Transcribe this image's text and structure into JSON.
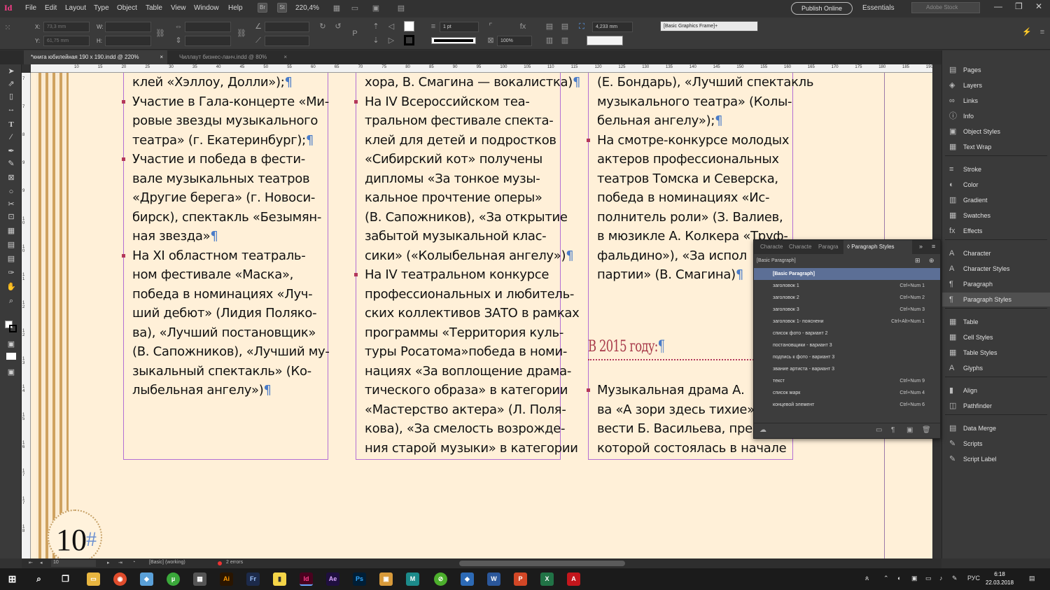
{
  "app": {
    "logo": "Id",
    "menu": [
      "File",
      "Edit",
      "Layout",
      "Type",
      "Object",
      "Table",
      "View",
      "Window",
      "Help"
    ],
    "menu_x": [
      36,
      64,
      93,
      134,
      167,
      208,
      244,
      277,
      326
    ],
    "zoom": "220,4%",
    "publish_label": "Publish Online",
    "workspace": "Essentials",
    "stock_placeholder": "Adobe Stock"
  },
  "control": {
    "x_label": "X:",
    "x_value": "73,3 mm",
    "y_label": "Y:",
    "y_value": "61,75 mm",
    "w_label": "W:",
    "h_label": "H:",
    "stroke_weight": "1 pt",
    "scale": "100%",
    "gap": "4,233 mm",
    "object_style": "[Basic Graphics Frame]+"
  },
  "tabs": [
    {
      "label": "*книга юбилейная 190 х 190.indd @ 220%",
      "close": "×"
    },
    {
      "label": "Чиллаут бизнес-ланч.indd @ 80%",
      "close": "×"
    }
  ],
  "ruler": {
    "h": [
      "10",
      "15",
      "20",
      "25",
      "30",
      "35",
      "40",
      "45",
      "50",
      "55",
      "60",
      "65",
      "70",
      "75",
      "80",
      "85",
      "90",
      "95",
      "100",
      "105",
      "110",
      "115",
      "120",
      "125",
      "130",
      "135",
      "140",
      "145",
      "150",
      "155",
      "160",
      "165",
      "170",
      "175",
      "180",
      "185",
      "190",
      "195"
    ],
    "v": [
      "7",
      "7",
      "8",
      "9",
      "9",
      "1\n0",
      "1\n0",
      "1\n1",
      "1\n2",
      "1\n2",
      "1\n3",
      "1\n4",
      "1\n5",
      "1\n6",
      "1\n7",
      "1\n7",
      "1\n8"
    ]
  },
  "document": {
    "page_number": "10",
    "page_hash": "#",
    "col1": [
      {
        "t": "клей «Хэллоу, Долли»);",
        "p": "¶"
      },
      {
        "t": "Участие в Гала-концерте «Ми-",
        "b": true
      },
      {
        "t": "ровые звезды музыкального"
      },
      {
        "t": "театра» (г. Екатеринбург);",
        "p": "¶"
      },
      {
        "t": "Участие и победа в фести-",
        "b": true
      },
      {
        "t": "вале музыкальных театров"
      },
      {
        "t": "«Другие берега» (г. Новоси-"
      },
      {
        "t": "бирск), спектакль «Безымян-"
      },
      {
        "t": "ная звезда»",
        "p": "¶"
      },
      {
        "t": "На XI областном театраль-",
        "b": true
      },
      {
        "t": "ном фестивале «Маска»,"
      },
      {
        "t": "победа в номинациях «Луч-"
      },
      {
        "t": "ший дебют» (Лидия Поляко-"
      },
      {
        "t": "ва), «Лучший постановщик»"
      },
      {
        "t": "(В. Сапожников), «Лучший му-"
      },
      {
        "t": "зыкальный спектакль» (Ко-"
      },
      {
        "t": "лыбельная ангелу»)",
        "p": "¶"
      }
    ],
    "col2": [
      {
        "t": "хора, В. Смагина — вокалистка)",
        "p": "¶"
      },
      {
        "t": "На IV Всероссийском теа-",
        "b": true
      },
      {
        "t": "тральном фестивале спекта-"
      },
      {
        "t": "клей для детей и подростков"
      },
      {
        "t": "«Сибирский кот» получены"
      },
      {
        "t": "дипломы «За тонкое музы-"
      },
      {
        "t": "кальное прочтение оперы»"
      },
      {
        "t": "(В. Сапожников), «За открытие"
      },
      {
        "t": "забытой музыкальной клас-"
      },
      {
        "t": "сики» («Колыбельная ангелу»)",
        "p": "¶"
      },
      {
        "t": "На IV театральном конкурсе",
        "b": true
      },
      {
        "t": "профессиональных и любитель-"
      },
      {
        "t": "ских коллективов ЗАТО в рамках"
      },
      {
        "t": "программы «Территория куль-"
      },
      {
        "t": "туры Росатома»победа в номи-"
      },
      {
        "t": "нациях «За воплощение драма-"
      },
      {
        "t": "тического образа» в категории"
      },
      {
        "t": "«Мастерство актера» (Л. Поля-"
      },
      {
        "t": "кова), «За смелость возрожде-"
      },
      {
        "t": "ния старой музыки» в категории"
      }
    ],
    "col3": [
      {
        "t": "(Е. Бондарь), «Лучший спектакль"
      },
      {
        "t": "музыкального театра» (Колы-"
      },
      {
        "t": "бельная ангелу»);",
        "p": "¶"
      },
      {
        "t": "На смотре-конкурсе молодых",
        "b": true
      },
      {
        "t": "актеров профессиональных"
      },
      {
        "t": "театров Томска и Северска,"
      },
      {
        "t": "победа в номинациях «Ис-"
      },
      {
        "t": "полнитель роли» (З. Валиев,"
      },
      {
        "t": "в мюзикле А. Колкера «Труф-"
      },
      {
        "t": "фальдино»), «За испол"
      },
      {
        "t": "партии» (В. Смагина)",
        "p": "¶"
      }
    ],
    "heading": "В 2015 году:",
    "heading_pil": "¶",
    "col3b": [
      {
        "t": "Музыкальная драма А.",
        "b": true
      },
      {
        "t": "ва «А зори здесь тихие»"
      },
      {
        "t": "вести Б. Васильева, пре"
      },
      {
        "t": "которой состоялась в начале"
      }
    ]
  },
  "panels": [
    {
      "label": "Pages",
      "icon": "▤"
    },
    {
      "label": "Layers",
      "icon": "◈"
    },
    {
      "label": "Links",
      "icon": "∞"
    },
    {
      "label": "Info",
      "icon": "ⓘ"
    },
    {
      "label": "Object Styles",
      "icon": "▣"
    },
    {
      "label": "Text Wrap",
      "icon": "▦"
    },
    {
      "label": "Stroke",
      "icon": "≡"
    },
    {
      "label": "Color",
      "icon": "◐"
    },
    {
      "label": "Gradient",
      "icon": "▥"
    },
    {
      "label": "Swatches",
      "icon": "▦"
    },
    {
      "label": "Effects",
      "icon": "fx"
    },
    {
      "label": "Character",
      "icon": "A"
    },
    {
      "label": "Character Styles",
      "icon": "A"
    },
    {
      "label": "Paragraph",
      "icon": "¶"
    },
    {
      "label": "Paragraph Styles",
      "icon": "¶"
    },
    {
      "label": "Table",
      "icon": "▦"
    },
    {
      "label": "Cell Styles",
      "icon": "▦"
    },
    {
      "label": "Table Styles",
      "icon": "▦"
    },
    {
      "label": "Glyphs",
      "icon": "A"
    },
    {
      "label": "Align",
      "icon": "▮"
    },
    {
      "label": "Pathfinder",
      "icon": "◫"
    },
    {
      "label": "Data Merge",
      "icon": "▤"
    },
    {
      "label": "Scripts",
      "icon": "✎"
    },
    {
      "label": "Script Label",
      "icon": "✎"
    }
  ],
  "paragraph_styles": {
    "tabs": [
      "Characte",
      "Characte",
      "Paragra",
      "Paragraph Styles"
    ],
    "current": "[Basic Paragraph]",
    "styles": [
      {
        "name": "[Basic Paragraph]",
        "sc": ""
      },
      {
        "name": "заголовок 1",
        "sc": "Ctrl+Num 1"
      },
      {
        "name": "заголовок 2",
        "sc": "Ctrl+Num 2"
      },
      {
        "name": "заголовок 3",
        "sc": "Ctrl+Num 3"
      },
      {
        "name": "заголовок 1- пояснени",
        "sc": "Ctrl+Alt+Num 1"
      },
      {
        "name": "список фото - вариант 2",
        "sc": ""
      },
      {
        "name": "постановщики - вариант 3",
        "sc": ""
      },
      {
        "name": "подпись к фото - вариант 3",
        "sc": ""
      },
      {
        "name": "звание артиста - вариант 3",
        "sc": ""
      },
      {
        "name": "текст",
        "sc": "Ctrl+Num 9"
      },
      {
        "name": "список марк",
        "sc": "Ctrl+Num 4"
      },
      {
        "name": "концевой элемент",
        "sc": "Ctrl+Num 6"
      }
    ]
  },
  "status": {
    "page": "10",
    "style": "[Basic] (working)",
    "errors": "2 errors"
  },
  "taskbar": {
    "lang": "РУС",
    "time": "6:18",
    "date": "22.03.2018"
  },
  "colors": {
    "page_bg": "#fff0d8",
    "frame": "#b36fd3",
    "bullet": "#b3375a",
    "heading": "#a83a4a",
    "pilcrow": "#4a7cc8",
    "selection": "#5c6f96"
  }
}
